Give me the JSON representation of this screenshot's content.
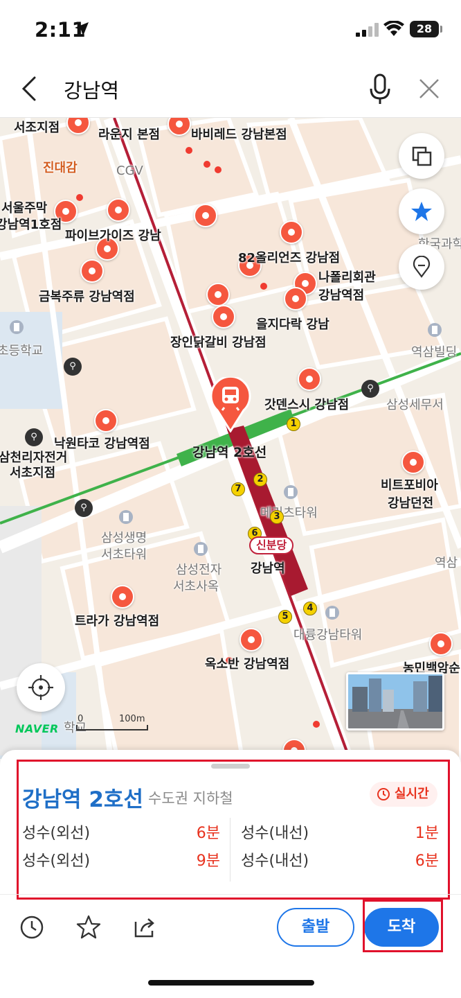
{
  "status_bar": {
    "time": "2:11",
    "battery": "28"
  },
  "search": {
    "query": "강남역"
  },
  "map": {
    "pois": {
      "seocho": "서조지점",
      "lounge": "라운지 본점",
      "babi": "바비레드 강남본점",
      "jindae": "진대감",
      "cgv": "CGV",
      "seoul_jumak_1": "서울주막",
      "seoul_jumak_2": "강남역1호점",
      "five_guys": "파이브가이즈 강남",
      "olive": "82올리언즈 강남점",
      "geumbok": "금복주류 강남역점",
      "napoli_1": "나폴리회관",
      "napoli_2": "강남역점",
      "euljiro": "을지다락 강남",
      "jangin": "장인닭갈비 강남점",
      "school": "초등학교",
      "yeoksam_bldg": "역삼빌딩",
      "godens": "갓덴스시 강남점",
      "samsung_tax": "삼성세무서",
      "nawon": "낙원타코 강남역점",
      "samcheolli_1": "삼천리자전거",
      "samcheolli_2": "서초지점",
      "bitpo_1": "비트포비아",
      "bitpo_2": "강남던전",
      "meritz": "메리츠타워",
      "samsung_life_1": "삼성생명",
      "samsung_life_2": "서초타워",
      "samsung_elec_1": "삼성전자",
      "samsung_elec_2": "서초사옥",
      "gangnam_station": "강남역",
      "traga": "트라가 강남역점",
      "daeryung": "대륭강남타워",
      "oksoban": "옥소반 강남역점",
      "nongmin": "농민백암순",
      "hangukgwa": "한국과학",
      "yeoksam_right": "역삼",
      "school_bottom": "학교"
    },
    "station_label": "강남역 2호선",
    "bundang_badge": "신분당",
    "exits": [
      "1",
      "2",
      "3",
      "4",
      "5",
      "6",
      "7"
    ],
    "naver_logo": "NAVER",
    "scale": {
      "zero": "0",
      "distance": "100m"
    }
  },
  "sheet": {
    "title": "강남역 2호선",
    "subtitle": "수도권 지하철",
    "realtime": "실시간",
    "arrivals": [
      {
        "direction": "성수(외선)",
        "time": "6분"
      },
      {
        "direction": "성수(내선)",
        "time": "1분"
      },
      {
        "direction": "성수(외선)",
        "time": "9분"
      },
      {
        "direction": "성수(내선)",
        "time": "6분"
      }
    ],
    "depart_label": "출발",
    "arrive_label": "도착"
  },
  "colors": {
    "line2_green": "#3fb24a",
    "sinbundang_red": "#c0213b",
    "accent_blue": "#1e76e8",
    "realtime_red": "#e8321e",
    "highlight_red": "#e0112b"
  }
}
